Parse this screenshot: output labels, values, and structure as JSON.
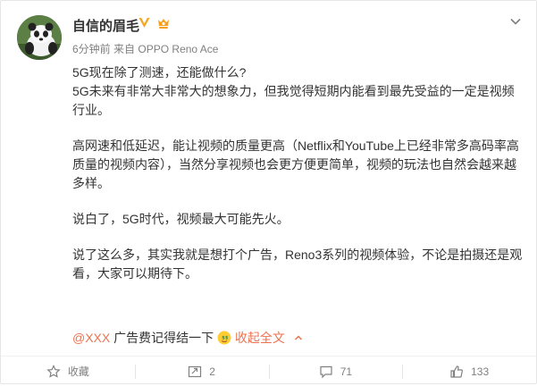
{
  "user": {
    "name": "自信的眉毛"
  },
  "meta": {
    "time": "6分钟前",
    "source_prefix": "来自",
    "device": "OPPO Reno Ace"
  },
  "post": {
    "p1": "5G现在除了测速，还能做什么?",
    "p2": "5G未来有非常大非常大的想象力，但我觉得短期内能看到最先受益的一定是视频行业。",
    "p3": "高网速和低延迟，能让视频的质量更高（Netflix和YouTube上已经非常多高码率高质量的视频内容），当然分享视频也会更方便更简单，视频的玩法也自然会越来越多样。",
    "p4": "说白了，5G时代，视频最大可能先火。",
    "p5": "说了这么多，其实我就是想打个广告，Reno3系列的视频体验，不论是拍摄还是观看，大家可以期待下。",
    "mention": "@XXX",
    "tail_text": " 广告费记得结一下",
    "collapse_label": "收起全文"
  },
  "actions": {
    "favorite_label": "收藏",
    "repost_count": "2",
    "comment_count": "71",
    "like_count": "133"
  },
  "colors": {
    "accent": "#eb7350",
    "text": "#333333",
    "muted": "#808080"
  }
}
